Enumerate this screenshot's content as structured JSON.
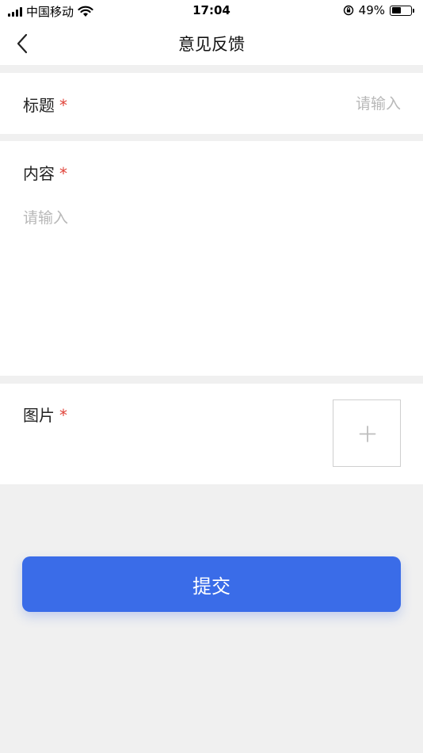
{
  "status_bar": {
    "carrier": "中国移动",
    "time": "17:04",
    "battery_percent": "49%",
    "battery_level": 0.49
  },
  "nav": {
    "title": "意见反馈",
    "back_icon": "chevron-left-icon"
  },
  "form": {
    "title_field": {
      "label": "标题",
      "required_mark": "*",
      "placeholder": "请输入",
      "value": ""
    },
    "content_field": {
      "label": "内容",
      "required_mark": "*",
      "placeholder": "请输入",
      "value": ""
    },
    "image_field": {
      "label": "图片",
      "required_mark": "*",
      "upload_icon": "plus-icon"
    }
  },
  "submit": {
    "label": "提交"
  },
  "colors": {
    "accent": "#3a6ce8",
    "required": "#e0443a",
    "placeholder": "#b8b8b8",
    "background": "#f0f0f0"
  }
}
